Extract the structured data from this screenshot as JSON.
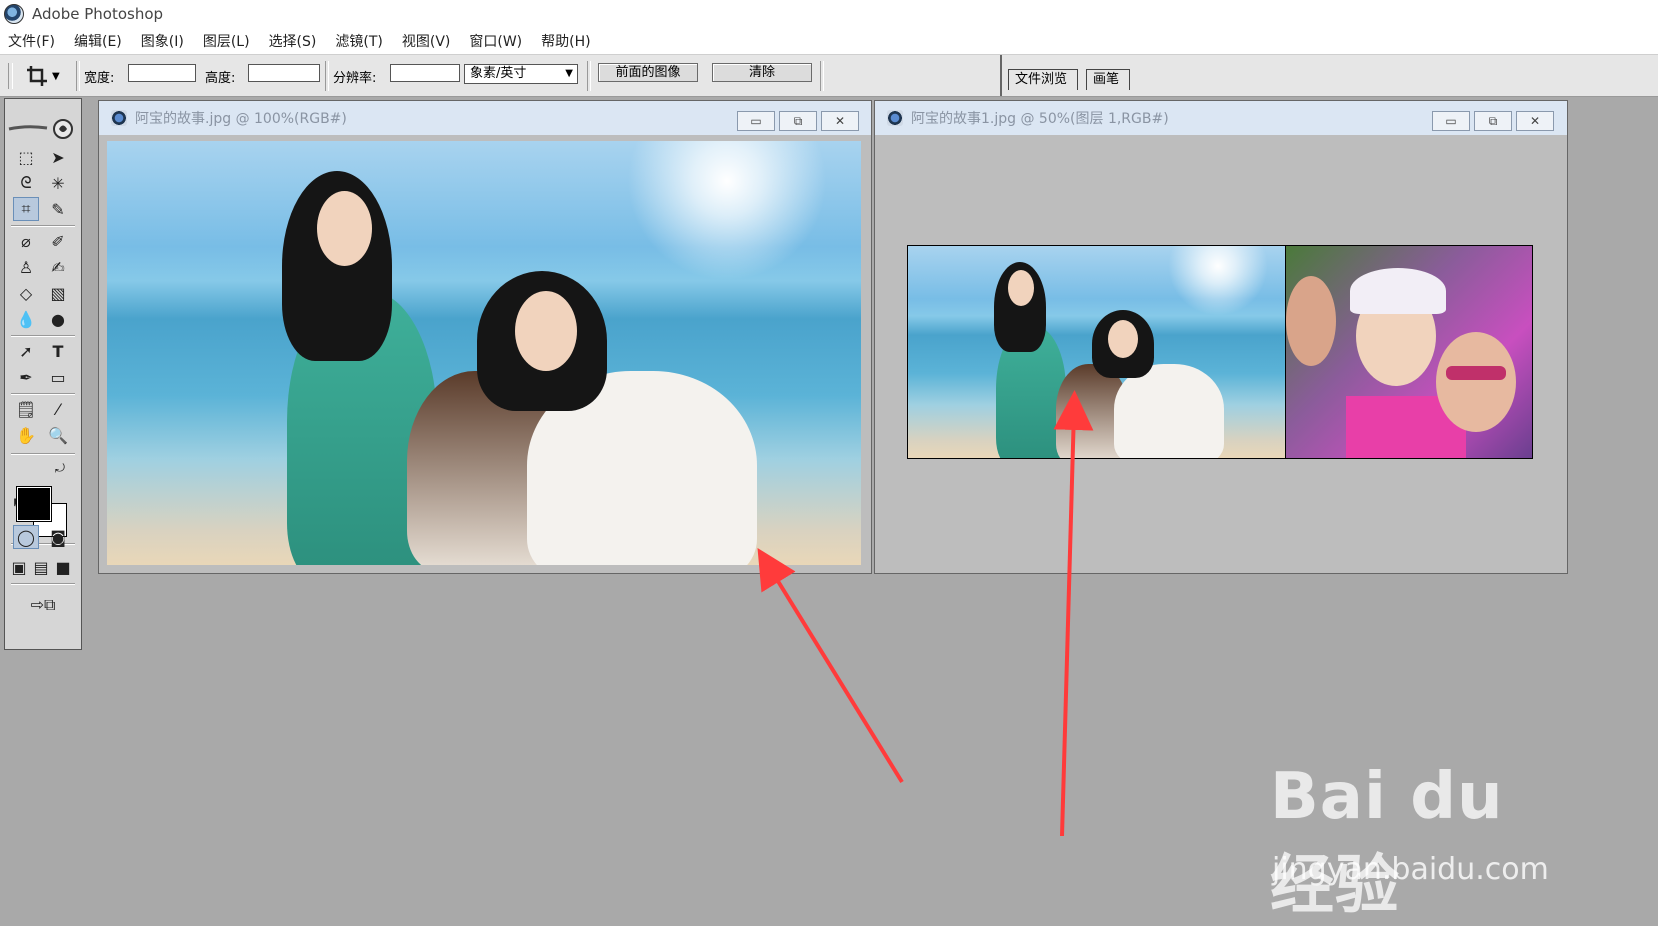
{
  "app": {
    "title": "Adobe Photoshop"
  },
  "menu": [
    "文件(F)",
    "编辑(E)",
    "图象(I)",
    "图层(L)",
    "选择(S)",
    "滤镜(T)",
    "视图(V)",
    "窗口(W)",
    "帮助(H)"
  ],
  "options": {
    "width_label": "宽度:",
    "width_value": "",
    "height_label": "高度:",
    "height_value": "",
    "resolution_label": "分辨率:",
    "resolution_value": "",
    "unit_select": "象素/英寸",
    "front_image_button": "前面的图像",
    "clear_button": "清除"
  },
  "palette_tabs": [
    "文件浏览",
    "画笔"
  ],
  "doc1": {
    "title": "阿宝的故事.jpg @ 100%(RGB#)"
  },
  "doc2": {
    "title": "阿宝的故事1.jpg @ 50%(图层 1,RGB#)"
  },
  "watermark": {
    "brand": "Bai du 经验",
    "url": "jingyan.baidu.com"
  },
  "colors": {
    "foreground": "#000000",
    "background": "#ffffff",
    "arrow": "#ff3b3b"
  }
}
